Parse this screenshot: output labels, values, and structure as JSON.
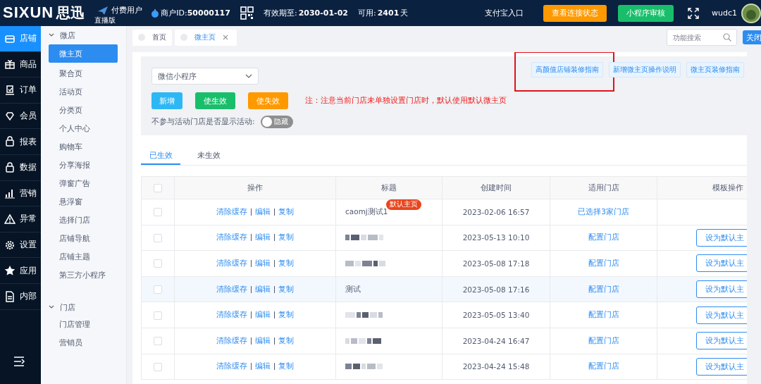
{
  "topbar": {
    "logo": "SIXUN",
    "logo_cn": "思迅",
    "edition": "直播版",
    "user_type": "付费用户",
    "merchant_id_label": "商户ID:",
    "merchant_id": "50000117",
    "valid_label": "有效期至:",
    "valid_until": "2030-01-02",
    "remaining_label": "可用:",
    "remaining": "2401",
    "remaining_unit": "天",
    "alipay": "支付宝入口",
    "buttons": [
      {
        "label": "查看连接状态",
        "color": "#ff9900"
      },
      {
        "label": "小程序审核",
        "color": "#19be6b"
      }
    ],
    "username": "wudc1"
  },
  "nav": [
    {
      "label": "店铺",
      "selected": true
    },
    {
      "label": "商品",
      "selected": false
    },
    {
      "label": "订单",
      "selected": false
    },
    {
      "label": "会员",
      "selected": false
    },
    {
      "label": "报表",
      "selected": false
    },
    {
      "label": "数据",
      "selected": false
    },
    {
      "label": "营销",
      "selected": false
    },
    {
      "label": "异常",
      "selected": false
    },
    {
      "label": "设置",
      "selected": false
    },
    {
      "label": "应用",
      "selected": false
    },
    {
      "label": "内部",
      "selected": false
    }
  ],
  "submenu": [
    {
      "label": "微店",
      "expanded": true,
      "children": [
        {
          "label": "微主页",
          "selected": true
        },
        {
          "label": "聚合页",
          "selected": false
        },
        {
          "label": "活动页",
          "selected": false
        },
        {
          "label": "分类页",
          "selected": false
        },
        {
          "label": "个人中心",
          "selected": false
        },
        {
          "label": "购物车",
          "selected": false
        },
        {
          "label": "分享海报",
          "selected": false
        },
        {
          "label": "弹窗广告",
          "selected": false
        },
        {
          "label": "悬浮窗",
          "selected": false
        },
        {
          "label": "选择门店",
          "selected": false
        },
        {
          "label": "店铺导航",
          "selected": false
        },
        {
          "label": "店铺主题",
          "selected": false
        },
        {
          "label": "第三方小程序",
          "selected": false
        }
      ]
    },
    {
      "label": "门店",
      "expanded": true,
      "children": [
        {
          "label": "门店管理",
          "selected": false
        },
        {
          "label": "营销员",
          "selected": false
        }
      ]
    }
  ],
  "page_tabs": [
    {
      "label": "首页",
      "selected": false,
      "closable": false
    },
    {
      "label": "微主页",
      "selected": true,
      "closable": true
    }
  ],
  "search": {
    "placeholder": "功能搜索"
  },
  "close_button": "关闭",
  "panel": {
    "select": {
      "value": "微信小程序"
    },
    "guides": [
      {
        "label": "高颜值店铺装修指南",
        "highlighted": true
      },
      {
        "label": "新增微主页操作说明",
        "highlighted": false
      },
      {
        "label": "微主页装修指南",
        "highlighted": false
      }
    ],
    "actions": [
      {
        "label": "新增",
        "color": "#2db7f5"
      },
      {
        "label": "使生效",
        "color": "#19be6b"
      },
      {
        "label": "使失效",
        "color": "#ff9900"
      }
    ],
    "note": "注：注意当前门店未单独设置门店时，默认使用默认微主页",
    "toggle_label": "不参与活动门店是否显示活动:",
    "toggle": {
      "on": false,
      "text": "隐藏"
    }
  },
  "status_tabs": [
    {
      "label": "已生效",
      "selected": true
    },
    {
      "label": "未生效",
      "selected": false
    }
  ],
  "table": {
    "header_checked": false,
    "columns": [
      "操作",
      "标题",
      "创建时间",
      "适用门店",
      "模板操作"
    ],
    "rows": [
      {
        "checked": false,
        "highlighted": false,
        "actions": [
          "清除缓存",
          "编辑",
          "复制"
        ],
        "kind": "text",
        "title": "caomj测试1",
        "badge": "默认主页",
        "created": "2023-02-06 16:57",
        "store": "已选择3家门店"
      },
      {
        "checked": false,
        "highlighted": false,
        "actions": [
          "清除缓存",
          "编辑",
          "复制"
        ],
        "kind": "redacted",
        "created": "2023-05-13 10:10",
        "store": "配置门店",
        "template_action": "设为默认主"
      },
      {
        "checked": false,
        "highlighted": false,
        "actions": [
          "清除缓存",
          "编辑",
          "复制"
        ],
        "kind": "redacted",
        "created": "2023-05-08 17:18",
        "store": "配置门店",
        "template_action": "设为默认主"
      },
      {
        "checked": false,
        "highlighted": true,
        "actions": [
          "清除缓存",
          "编辑",
          "复制"
        ],
        "kind": "text",
        "title": "测试",
        "created": "2023-05-08 17:16",
        "store": "配置门店",
        "template_action": "设为默认主"
      },
      {
        "checked": false,
        "highlighted": false,
        "actions": [
          "清除缓存",
          "编辑",
          "复制"
        ],
        "kind": "redacted",
        "created": "2023-05-05 13:40",
        "store": "配置门店",
        "template_action": "设为默认主"
      },
      {
        "checked": false,
        "highlighted": false,
        "actions": [
          "清除缓存",
          "编辑",
          "复制"
        ],
        "kind": "redacted",
        "created": "2023-04-24 16:47",
        "store": "配置门店",
        "template_action": "设为默认主"
      },
      {
        "checked": false,
        "highlighted": false,
        "actions": [
          "清除缓存",
          "编辑",
          "复制"
        ],
        "kind": "redacted",
        "created": "2023-04-24 15:48",
        "store": "配置门店",
        "template_action": "设为默认主"
      }
    ]
  }
}
